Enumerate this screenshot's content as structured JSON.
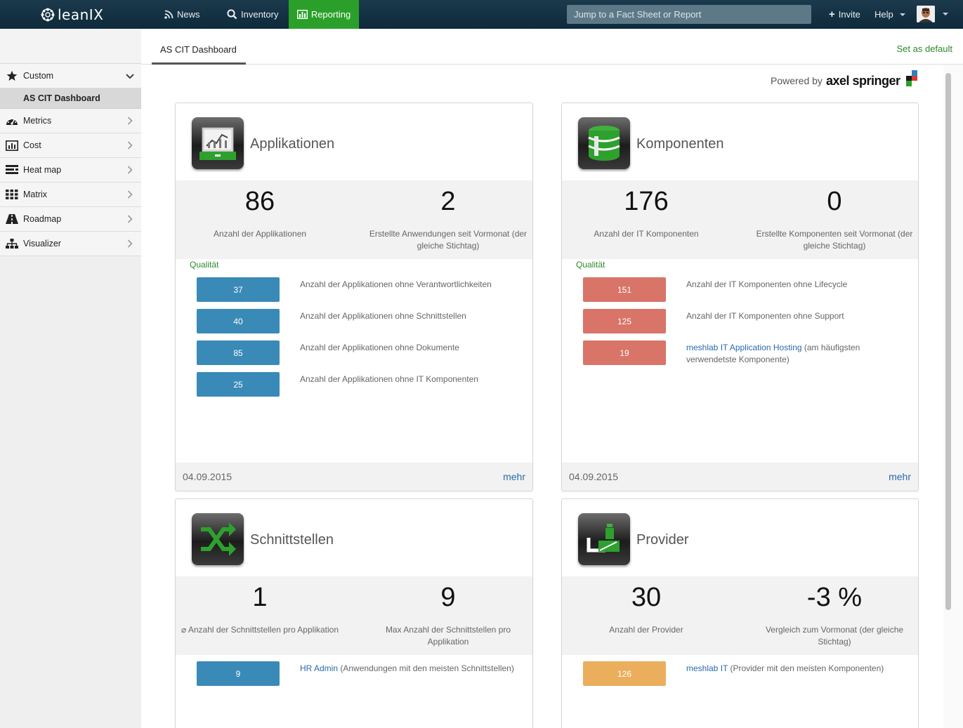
{
  "app": {
    "logo_text": "leanIX"
  },
  "nav": {
    "news": "News",
    "inventory": "Inventory",
    "reporting": "Reporting",
    "search_placeholder": "Jump to a Fact Sheet or Report",
    "invite": "Invite",
    "help": "Help"
  },
  "sidebar": {
    "items": [
      {
        "label": "Custom",
        "icon": "star-icon"
      },
      {
        "label": "Metrics",
        "icon": "dashboard-gauge-icon"
      },
      {
        "label": "Cost",
        "icon": "bar-chart-icon"
      },
      {
        "label": "Heat map",
        "icon": "heatmap-icon"
      },
      {
        "label": "Matrix",
        "icon": "grid-icon"
      },
      {
        "label": "Roadmap",
        "icon": "road-icon"
      },
      {
        "label": "Visualizer",
        "icon": "sitemap-icon"
      }
    ],
    "sub_active": "AS CIT Dashboard"
  },
  "header": {
    "tab": "AS CIT Dashboard",
    "set_default": "Set as default",
    "powered_label": "Powered by",
    "powered_brand": "axel springer"
  },
  "colors": {
    "accent_green": "#2aa02a",
    "blue": "#3a8ab8",
    "red": "#d87468",
    "orange": "#ebae5c",
    "link": "#2a6aad"
  },
  "cards": {
    "applikationen": {
      "title": "Applikationen",
      "kpi1_value": "86",
      "kpi1_label": "Anzahl der Applikationen",
      "kpi2_value": "2",
      "kpi2_label": "Erstellte Anwendungen seit Vormonat (der gleiche Stichtag)",
      "quality_label": "Qualität",
      "rows": [
        {
          "value": "37",
          "text": "Anzahl der Applikationen ohne Verantwortlichkeiten"
        },
        {
          "value": "40",
          "text": "Anzahl der Applikationen ohne Schnittstellen"
        },
        {
          "value": "85",
          "text": "Anzahl der Applikationen ohne Dokumente"
        },
        {
          "value": "25",
          "text": "Anzahl der Applikationen ohne IT Komponenten"
        }
      ],
      "date": "04.09.2015",
      "more": "mehr"
    },
    "komponenten": {
      "title": "Komponenten",
      "kpi1_value": "176",
      "kpi1_label": "Anzahl der IT Komponenten",
      "kpi2_value": "0",
      "kpi2_label": "Erstellte Komponenten seit Vormonat (der gleiche Stichtag)",
      "quality_label": "Qualität",
      "rows": [
        {
          "value": "151",
          "text": "Anzahl der IT Komponenten ohne Lifecycle"
        },
        {
          "value": "125",
          "text": "Anzahl der IT Komponenten ohne Support"
        },
        {
          "value": "19",
          "link": "meshlab IT Application Hosting",
          "text": " (am häufigsten verwendetste Komponente)"
        }
      ],
      "date": "04.09.2015",
      "more": "mehr"
    },
    "schnittstellen": {
      "title": "Schnittstellen",
      "kpi1_value": "1",
      "kpi1_label": "⌀ Anzahl der Schnittstellen pro Applikation",
      "kpi2_value": "9",
      "kpi2_label": "Max Anzahl der Schnittstellen pro Applikation",
      "rows": [
        {
          "value": "9",
          "link": "HR Admin",
          "text": " (Anwendungen mit den meisten Schnittstellen)"
        }
      ]
    },
    "provider": {
      "title": "Provider",
      "kpi1_value": "30",
      "kpi1_label": "Anzahl der Provider",
      "kpi2_value": "-3 %",
      "kpi2_label": "Vergleich zum Vormonat (der gleiche Stichtag)",
      "rows": [
        {
          "value": "126",
          "link": "meshlab IT",
          "text": " (Provider mit den meisten Komponenten)"
        }
      ]
    }
  }
}
